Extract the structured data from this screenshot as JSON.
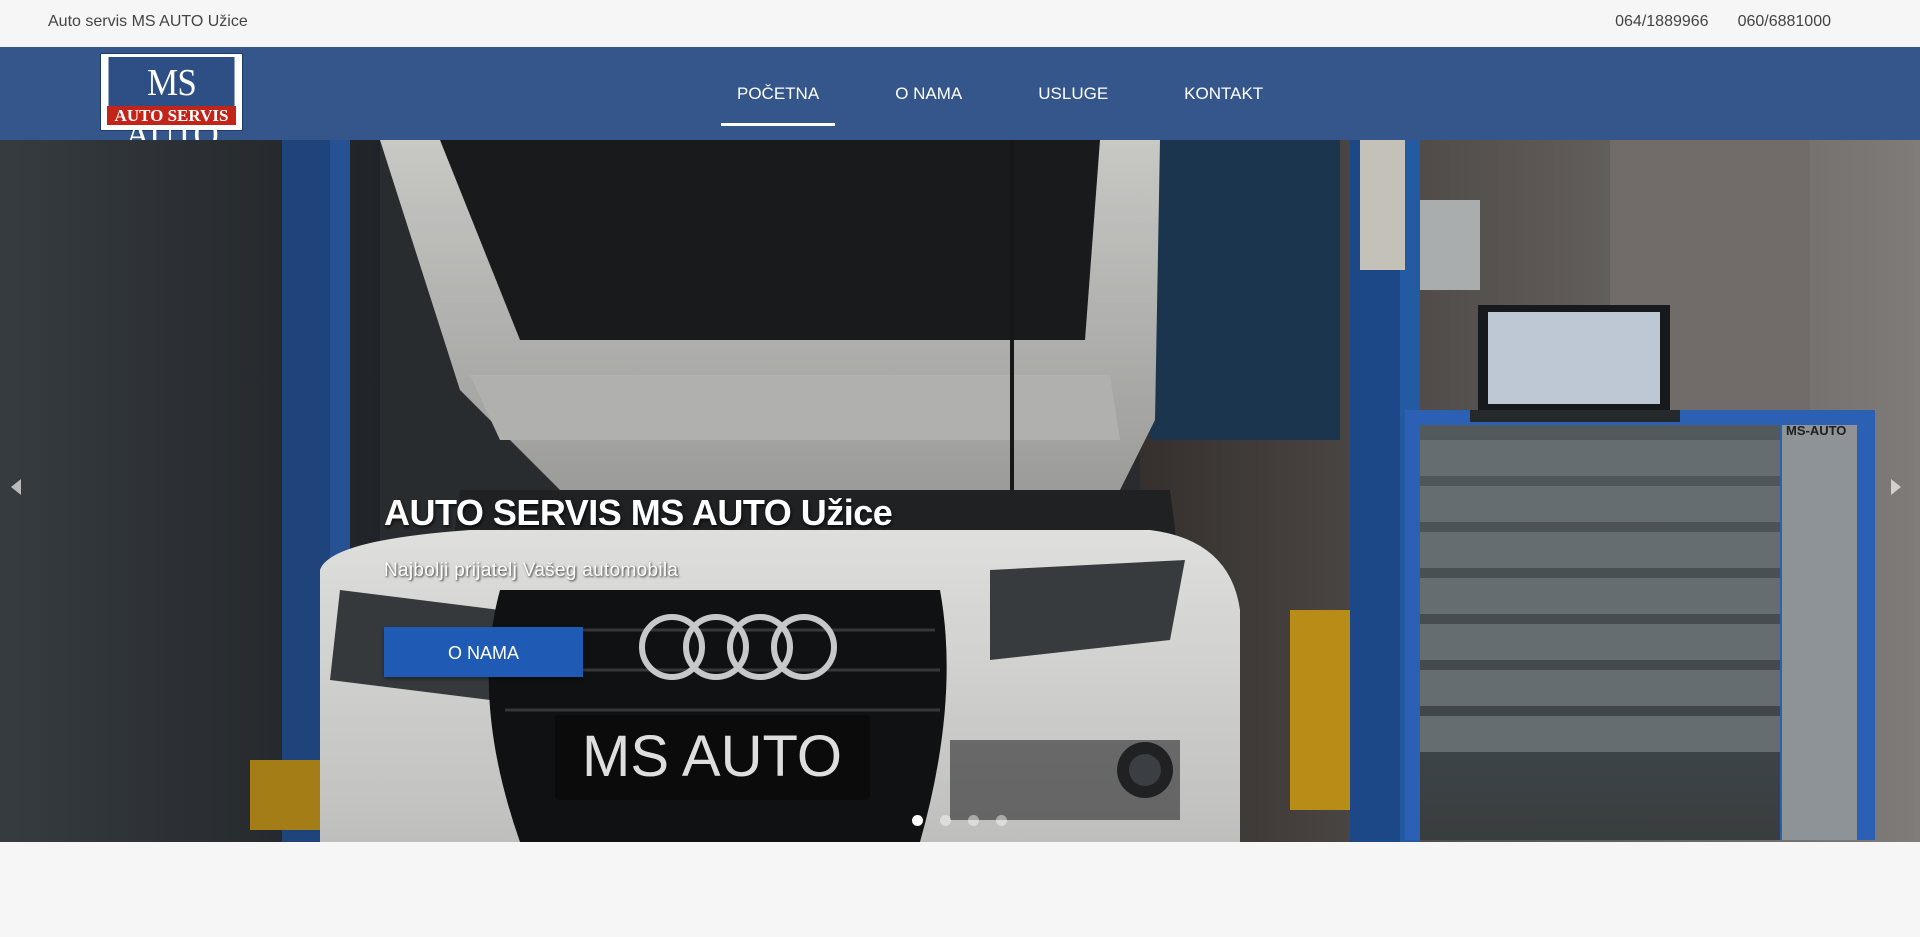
{
  "topbar": {
    "site_name": "Auto servis MS AUTO Užice",
    "phone_1": "064/1889966",
    "phone_2": "060/6881000"
  },
  "logo": {
    "line1": "MS AUTO",
    "line2": "AUTO SERVIS"
  },
  "nav": {
    "items": [
      {
        "label": "POČETNA",
        "active": true
      },
      {
        "label": "O NAMA"
      },
      {
        "label": "USLUGE"
      },
      {
        "label": "KONTAKT"
      }
    ]
  },
  "hero": {
    "title": "AUTO SERVIS MS AUTO Užice",
    "subtitle": "Najbolji prijatelj Vašeg automobila",
    "button_label": "O NAMA",
    "plate_text": "MS AUTO",
    "cabinet_label": "MS-AUTO",
    "slide_count": 4,
    "active_slide": 1
  },
  "colors": {
    "navbar": "#34568b",
    "button": "#1f5bb5",
    "logo_red": "#c2241a",
    "topbar_bg": "#f6f6f6"
  },
  "icons": [
    "chevron-left-icon",
    "chevron-right-icon"
  ]
}
